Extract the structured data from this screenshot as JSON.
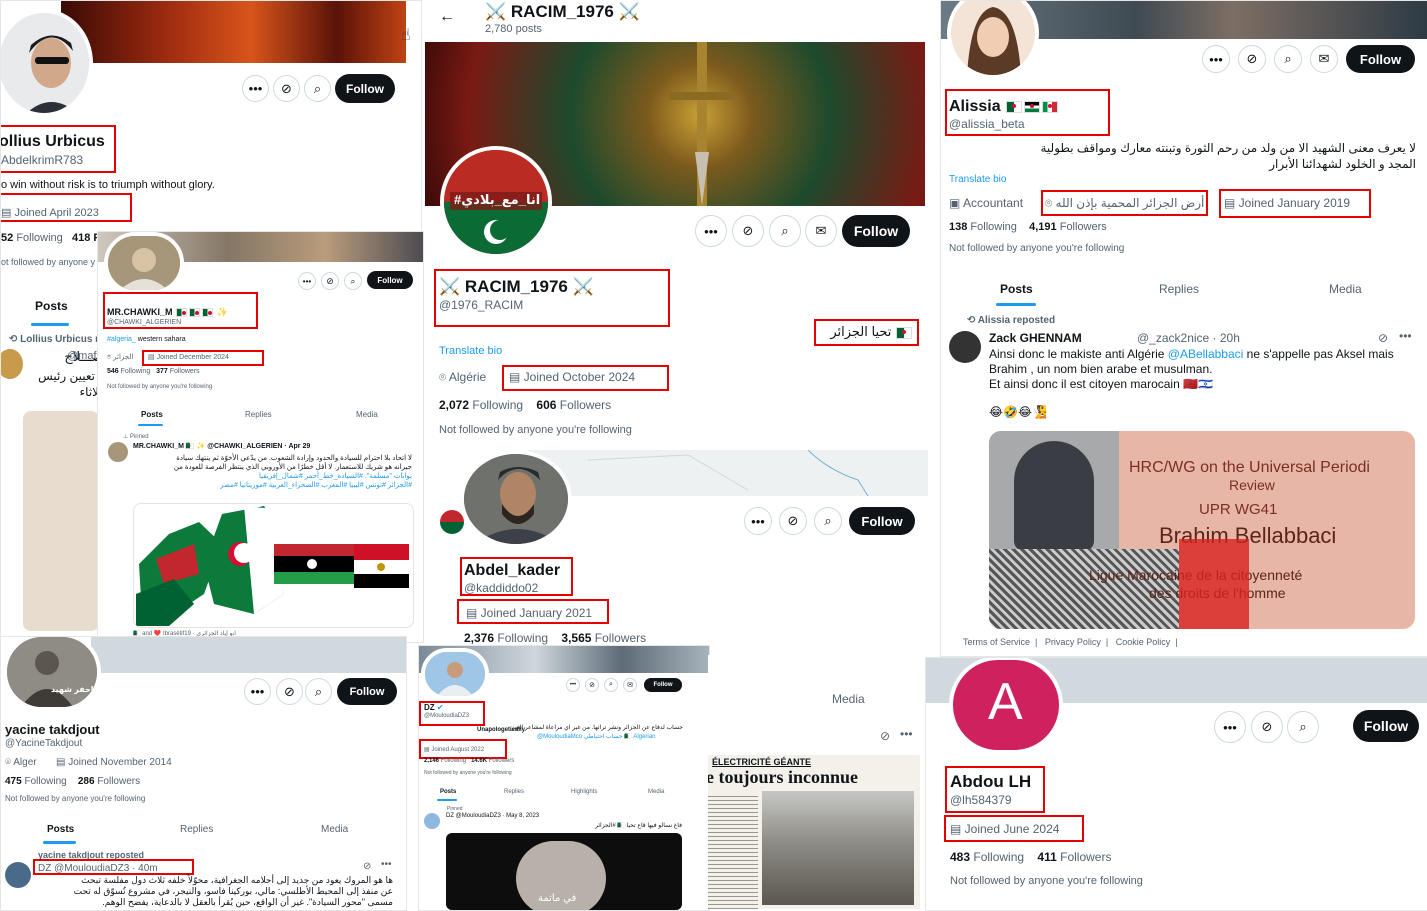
{
  "p1": {
    "follow": "Follow",
    "name": "ollius Urbicus",
    "handle": "AbdelkrimR783",
    "bio": "o win without risk is to triumph without glory.",
    "joined": "Joined April 2023",
    "following": "52",
    "following_label": "Following",
    "followers_partial": "418 F",
    "not_followed": "ot followed by anyone y",
    "tab_posts": "Posts",
    "reposter": "Lollius Urbicus r",
    "tweet_name": "صـــلاح",
    "tweet_handle": "@mafi",
    "tweet_text1": "تعيين رئيس",
    "tweet_text2": "لاثاء"
  },
  "p2": {
    "back_icon": "arrow-left-icon",
    "title": "⚔️ RACIM_1976 ⚔️",
    "posts_count": "2,780 posts",
    "follow": "Follow",
    "name": "⚔️ RACIM_1976 ⚔️",
    "handle": "@1976_RACIM",
    "bio": "تحيا الجزائر",
    "translate": "Translate bio",
    "location": "Algérie",
    "joined": "Joined October 2024",
    "following": "2,072",
    "following_label": "Following",
    "followers": "606",
    "followers_label": "Followers",
    "not_followed": "Not followed by anyone you're following",
    "avatar_text": "#انا_مع_بلادي"
  },
  "p3": {
    "follow": "Follow",
    "name": "Alissia",
    "handle": "@alissia_beta",
    "bio1": "لا يعرف معنى الشهيد الا من ولد من رحم الثورة وتبنته معارك ومواقف بطولية",
    "bio2": "المجد و الخلود لشهدائنا الأبرار",
    "translate": "Translate bio",
    "profession": "Accountant",
    "location": "أرض الجزائر المحمية بإذن الله",
    "joined": "Joined January 2019",
    "following": "138",
    "following_label": "Following",
    "followers": "4,191",
    "followers_label": "Followers",
    "not_followed": "Not followed by anyone you're following",
    "tabs": [
      "Posts",
      "Replies",
      "Media"
    ],
    "reposted": "Alissia",
    "reposted_suffix": "reposted",
    "tweet_name": "Zack GHENNAM",
    "tweet_handle": "@_zack2nice · 20h",
    "tweet_line1": "Ainsi donc le makiste anti Algérie ",
    "tweet_mention": "@ABellabbaci",
    "tweet_line1b": " ne s'appelle pas Aksel mais",
    "tweet_line2": "Brahim , un nom bien arabe et musulman.",
    "tweet_line3": "Et ainsi donc il est citoyen marocain 🇲🇦🇮🇱",
    "emoji": "😂🤣😂🧏",
    "img_text1": "HRC/WG on the Universal Periodi",
    "img_text2": "Review",
    "img_text3": "UPR WG41",
    "img_text4": "Brahim Bellabbaci",
    "img_text5": "Ligue Marocaine de la citoyenneté",
    "img_text6": "des droits de l'homme",
    "footer": [
      "Terms of Service",
      "Privacy Policy",
      "Cookie Policy"
    ]
  },
  "p4": {
    "follow": "Follow",
    "name": "MR.CHAWKI_M",
    "handle": "@CHAWKI_ALGERIEN",
    "bio_tag": "#algeria_",
    "bio_rest": " western sahara",
    "location": "الجزائر",
    "joined": "Joined December 2024",
    "following": "546",
    "following_label": "Following",
    "followers": "377",
    "followers_label": "Followers",
    "not_followed": "Not followed by anyone you're following",
    "tabs": [
      "Posts",
      "Replies",
      "Media"
    ],
    "pinned": "Pinned",
    "tweet_head": "MR.CHAWKI_M 🇩🇿 ✨ @CHAWKI_ALGERIEN · Apr 29",
    "tweet_l1": "لا اتحاد بلا احترام للسيادة والحدود وإرادة الشعوب. من يدّعي الأخوّة ثم ينتهك سيادة",
    "tweet_l2": "جيرانه هو شريك للاستعمار. لا أقل خطرًا من الأوروبي الذي ينتظر الفرصة للعودة من",
    "tweet_l3": "بوابات \"مسلمة\". #السيادة_خط_أحمر #شمال_إفريقيا",
    "tweet_l4": "#الجزائر #تونس #ليبيا #المغرب #الصحراء_الغربية #موريتانيا #مصر",
    "footer_text": "🇩🇿 and ❤️ Ibrasétif19 · ابو إياد الجزائري"
  },
  "p5": {
    "follow": "Follow",
    "name": "Abdel_kader",
    "handle": "@kaddiddo02",
    "joined": "Joined January 2021",
    "following": "2,376",
    "following_label": "Following",
    "followers": "3,565",
    "followers_label": "Followers"
  },
  "p6": {
    "follow": "Follow",
    "name": "yacine takdjout",
    "handle": "@YacineTakdjout",
    "location": "Alger",
    "joined": "Joined November 2014",
    "following": "475",
    "following_label": "Following",
    "followers": "286",
    "followers_label": "Followers",
    "not_followed": "Not followed by anyone you're following",
    "tabs": [
      "Posts",
      "Replies",
      "Media"
    ],
    "reposted": "yacine takdjout reposted",
    "tweet_head": "DZ @MouloudiaDZ3 · 40m",
    "tweet_l1": "ها هو المروك يعود من جديد إلى أحلامه الجغرافية، محوّلاً خلفه ثلاث دول مفلسة تبحث",
    "tweet_l2": "عن منفذ إلى المحيط الأطلسي: مالي، بوركينا فاسو، والنيجر، في مشروع تُسوّق له تحت",
    "tweet_l3": "مسمى \"محور السيادة\". غير أن الواقع، حين يُقرأ بالعقل لا بالدعاية، يفضح الوهم.",
    "avatar_caption": "احفر شهيد"
  },
  "p7": {
    "follow": "Follow",
    "name": "DZ",
    "handle": "@MouloudiaDZ3",
    "bio1": "حساب لدفاع عن الجزائر ونشر تراثها. من غير اي مراعاة لمشاعر الغير",
    "bio2": "Unapologetically",
    "bio3": "@MouloudiaMco حساب احتياطي 🇩🇿 Algerian",
    "joined": "Joined August 2022",
    "following": "2,146",
    "following_label": "Following",
    "followers": "14.6K",
    "followers_label": "Followers",
    "not_followed": "Not followed by anyone you're following",
    "tabs": [
      "Posts",
      "Replies",
      "Highlights",
      "Media"
    ],
    "pinned": "Pinned",
    "tweet_head": "DZ @MouloudiaDZ3 · May 8, 2023",
    "tweet_text": "فاغ نسالو فيها قاع تحيا 🇩🇿 #الجزائر",
    "video_caption": "في ماتمة"
  },
  "p8": {
    "media_tab": "Media",
    "headline1": "ÉLECTRICITÉ GÉANTE",
    "headline2": "e toujours inconnue"
  },
  "p9": {
    "follow": "Follow",
    "avatar_letter": "A",
    "name": "Abdou LH",
    "handle": "@lh584379",
    "joined": "Joined June 2024",
    "following": "483",
    "following_label": "Following",
    "followers": "411",
    "followers_label": "Followers",
    "not_followed": "Not followed by anyone you're following"
  },
  "colors": {
    "highlight": "#e60000",
    "link": "#1d9bf0",
    "follow_bg": "#0f1419",
    "muted": "#536471",
    "avatar_pink": "#d0215f"
  }
}
